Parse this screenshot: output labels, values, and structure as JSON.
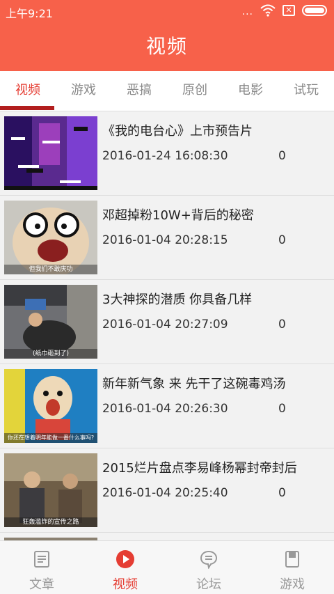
{
  "status_bar": {
    "time": "上午9:21",
    "dots": "...",
    "sim": "✕"
  },
  "header": {
    "title": "视频"
  },
  "tabs": [
    {
      "label": "视频",
      "active": true
    },
    {
      "label": "游戏",
      "active": false
    },
    {
      "label": "恶搞",
      "active": false
    },
    {
      "label": "原创",
      "active": false
    },
    {
      "label": "电影",
      "active": false
    },
    {
      "label": "试玩",
      "active": false
    }
  ],
  "videos": [
    {
      "title": "《我的电台心》上市预告片",
      "date": "2016-01-24 16:08:30",
      "count": "0"
    },
    {
      "title": "邓超掉粉10W+背后的秘密",
      "date": "2016-01-04 20:28:15",
      "count": "0",
      "caption": "但我们不敢庆功"
    },
    {
      "title": "3大神探的潜质 你具备几样",
      "date": "2016-01-04 20:27:09",
      "count": "0",
      "caption": "(纸巾砸到了)"
    },
    {
      "title": "新年新气象 来 先干了这碗毒鸡汤",
      "date": "2016-01-04 20:26:30",
      "count": "0",
      "caption": "你还在想着明年能做一番什么事吗?"
    },
    {
      "title": "2015烂片盘点李易峰杨幂封帝封后",
      "date": "2016-01-04 20:25:40",
      "count": "0",
      "caption": "狂轰滥炸的宣传之路"
    }
  ],
  "bottom_nav": [
    {
      "label": "文章",
      "icon": "article-icon",
      "active": false
    },
    {
      "label": "视频",
      "icon": "video-play-icon",
      "active": true
    },
    {
      "label": "论坛",
      "icon": "forum-icon",
      "active": false
    },
    {
      "label": "游戏",
      "icon": "game-icon",
      "active": false
    }
  ],
  "colors": {
    "accent": "#f7614a",
    "active_text": "#e53d33",
    "indicator": "#b21e1e"
  }
}
